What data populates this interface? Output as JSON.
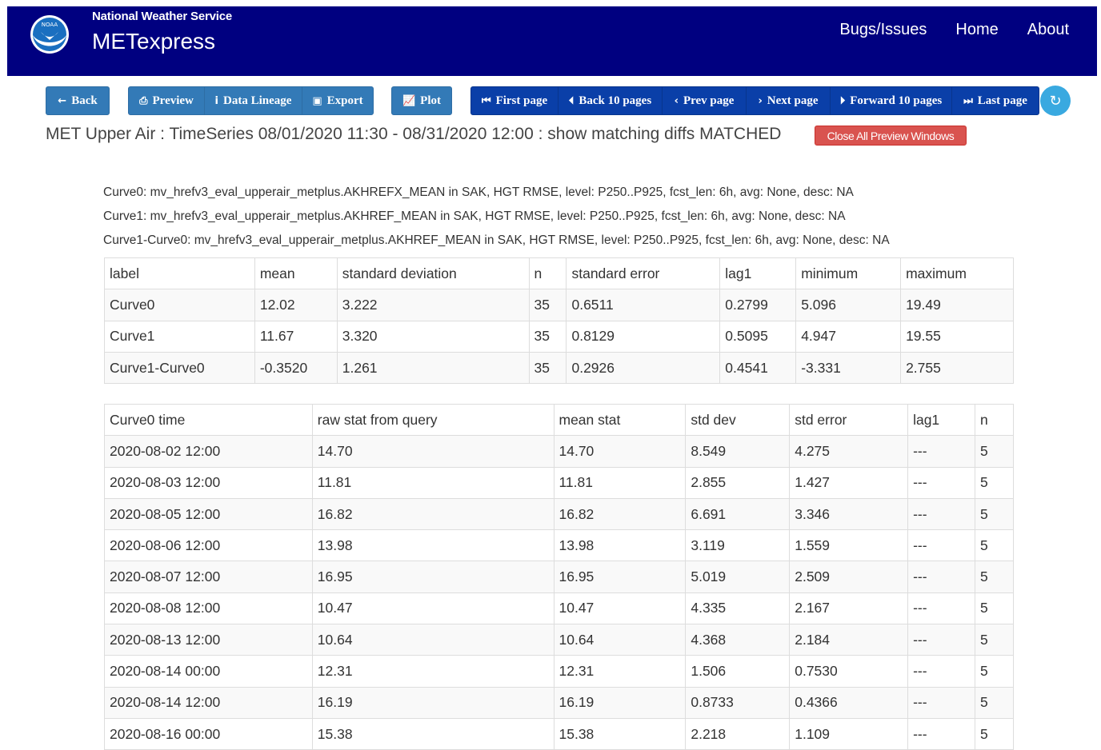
{
  "header": {
    "org": "National Weather Service",
    "title": "METexpress",
    "nav": [
      "Bugs/Issues",
      "Home",
      "About"
    ],
    "colors": {
      "navbar": "#000080",
      "primary": "#337ab7",
      "pager": "#0a3fa8",
      "danger": "#d9534f"
    }
  },
  "toolbar": {
    "back": "Back",
    "preview": "Preview",
    "lineage": "Data Lineage",
    "export": "Export",
    "plot": "Plot",
    "first": "First page",
    "back10": "Back 10 pages",
    "prev": "Prev page",
    "next": "Next page",
    "forward10": "Forward 10 pages",
    "last": "Last page",
    "refresh_icon": "refresh-icon"
  },
  "page": {
    "heading": "MET Upper Air : TimeSeries 08/01/2020 11:30 - 08/31/2020 12:00 : show matching diffs MATCHED",
    "close_all": "Close All Preview Windows",
    "curves": [
      "Curve0: mv_hrefv3_eval_upperair_metplus.AKHREFX_MEAN in SAK, HGT RMSE, level: P250..P925, fcst_len: 6h, avg: None, desc: NA",
      "Curve1: mv_hrefv3_eval_upperair_metplus.AKHREF_MEAN in SAK, HGT RMSE, level: P250..P925, fcst_len: 6h, avg: None, desc: NA",
      "Curve1-Curve0: mv_hrefv3_eval_upperair_metplus.AKHREF_MEAN in SAK, HGT RMSE, level: P250..P925, fcst_len: 6h, avg: None, desc: NA"
    ]
  },
  "summary": {
    "headers": [
      "label",
      "mean",
      "standard deviation",
      "n",
      "standard error",
      "lag1",
      "minimum",
      "maximum"
    ],
    "rows": [
      [
        "Curve0",
        "12.02",
        "3.222",
        "35",
        "0.6511",
        "0.2799",
        "5.096",
        "19.49"
      ],
      [
        "Curve1",
        "11.67",
        "3.320",
        "35",
        "0.8129",
        "0.5095",
        "4.947",
        "19.55"
      ],
      [
        "Curve1-Curve0",
        "-0.3520",
        "1.261",
        "35",
        "0.2926",
        "0.4541",
        "-3.331",
        "2.755"
      ]
    ]
  },
  "detail": {
    "headers": [
      "Curve0 time",
      "raw stat from query",
      "mean stat",
      "std dev",
      "std error",
      "lag1",
      "n"
    ],
    "rows": [
      [
        "2020-08-02 12:00",
        "14.70",
        "14.70",
        "8.549",
        "4.275",
        "---",
        "5"
      ],
      [
        "2020-08-03 12:00",
        "11.81",
        "11.81",
        "2.855",
        "1.427",
        "---",
        "5"
      ],
      [
        "2020-08-05 12:00",
        "16.82",
        "16.82",
        "6.691",
        "3.346",
        "---",
        "5"
      ],
      [
        "2020-08-06 12:00",
        "13.98",
        "13.98",
        "3.119",
        "1.559",
        "---",
        "5"
      ],
      [
        "2020-08-07 12:00",
        "16.95",
        "16.95",
        "5.019",
        "2.509",
        "---",
        "5"
      ],
      [
        "2020-08-08 12:00",
        "10.47",
        "10.47",
        "4.335",
        "2.167",
        "---",
        "5"
      ],
      [
        "2020-08-13 12:00",
        "10.64",
        "10.64",
        "4.368",
        "2.184",
        "---",
        "5"
      ],
      [
        "2020-08-14 00:00",
        "12.31",
        "12.31",
        "1.506",
        "0.7530",
        "---",
        "5"
      ],
      [
        "2020-08-14 12:00",
        "16.19",
        "16.19",
        "0.8733",
        "0.4366",
        "---",
        "5"
      ],
      [
        "2020-08-16 00:00",
        "15.38",
        "15.38",
        "2.218",
        "1.109",
        "---",
        "5"
      ]
    ]
  }
}
